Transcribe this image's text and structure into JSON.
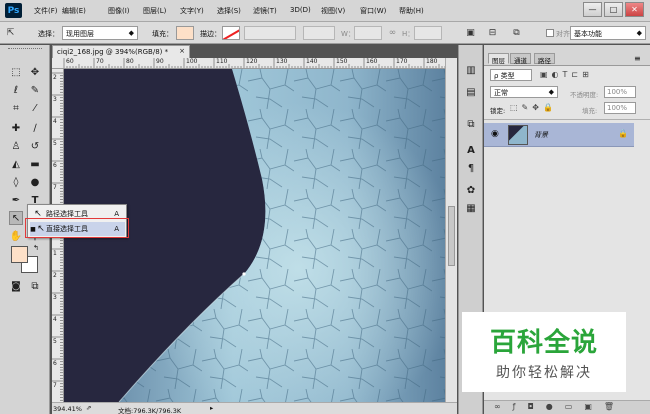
{
  "app": {
    "logo": "Ps"
  },
  "menu": [
    "文件(F)",
    "编辑(E)",
    "图像(I)",
    "图层(L)",
    "文字(Y)",
    "选择(S)",
    "滤镜(T)",
    "3D(D)",
    "视图(V)",
    "窗口(W)",
    "帮助(H)"
  ],
  "window_controls": {
    "minimize": "—",
    "restore": "□",
    "close": "✕"
  },
  "options": {
    "select_label": "选择：",
    "select_value": "现用图层",
    "fill_label": "填充：",
    "stroke_label": "描边：",
    "w_label": "W：",
    "h_label": "H：",
    "align_edges_label": "对齐",
    "workspace_value": "基本功能"
  },
  "document": {
    "tab_title": "ciqi2_168.jpg @ 394%(RGB/8) *",
    "tab_close": "×",
    "ruler_top": [
      "60",
      "70",
      "80",
      "90",
      "100",
      "110",
      "120",
      "130",
      "140",
      "150",
      "160",
      "170",
      "180"
    ],
    "ruler_left": [
      "2",
      "3",
      "4",
      "5",
      "6",
      "7",
      "8",
      "9",
      "1",
      "2",
      "3",
      "4",
      "5",
      "6",
      "7"
    ],
    "zoom": "394.41%",
    "doc_info": "文档:796.3K/796.3K"
  },
  "flyout": {
    "items": [
      {
        "label": "路径选择工具",
        "shortcut": "A"
      },
      {
        "label": "直接选择工具",
        "shortcut": "A"
      }
    ]
  },
  "panel": {
    "tabs": [
      "图层",
      "通道",
      "路径"
    ],
    "kind_label": "ρ 类型",
    "blend_mode": "正常",
    "opacity_label": "不透明度:",
    "opacity_value": "100%",
    "lock_label": "锁定:",
    "fill_label": "填充:",
    "fill_value": "100%",
    "layer_name": "背景"
  },
  "watermark": {
    "title": "百科全说",
    "subtitle": "助你轻松解决"
  },
  "colors": {
    "foreground": "#fde0c8",
    "background": "#ffffff",
    "selected_layer": "#a9b6d6",
    "highlight_box": "#e23a3a"
  }
}
